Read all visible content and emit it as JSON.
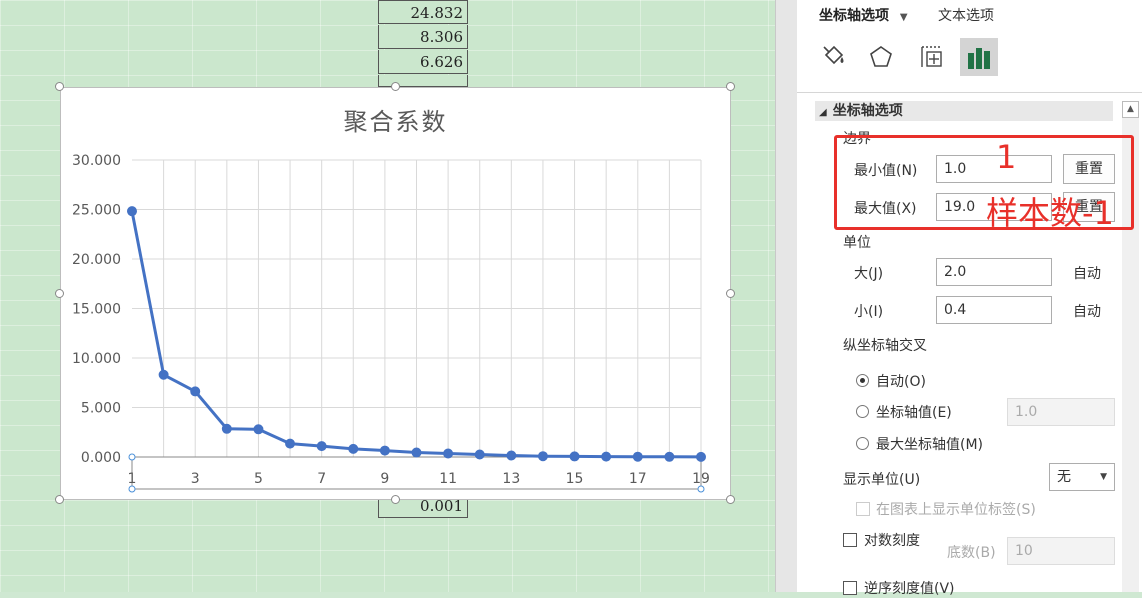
{
  "sheet": {
    "cells": [
      "24.832",
      "8.306",
      "6.626",
      "0.001"
    ]
  },
  "chart_data": {
    "type": "line",
    "title": "聚合系数",
    "x": [
      1,
      2,
      3,
      4,
      5,
      6,
      7,
      8,
      9,
      10,
      11,
      12,
      13,
      14,
      15,
      16,
      17,
      18,
      19
    ],
    "series": [
      {
        "values": [
          24.832,
          8.306,
          6.626,
          2.85,
          2.8,
          1.35,
          1.1,
          0.82,
          0.65,
          0.45,
          0.35,
          0.25,
          0.15,
          0.08,
          0.06,
          0.04,
          0.03,
          0.02,
          0.01
        ],
        "color": "#4472c4"
      }
    ],
    "xlim": [
      1,
      19
    ],
    "xticks": [
      "1",
      "3",
      "5",
      "7",
      "9",
      "11",
      "13",
      "15",
      "17",
      "19"
    ],
    "ylim": [
      0,
      30
    ],
    "yticks": [
      "0.000",
      "5.000",
      "10.000",
      "15.000",
      "20.000",
      "25.000",
      "30.000"
    ],
    "grid": true,
    "marker": "circle"
  },
  "pane": {
    "tab_axis": "坐标轴选项",
    "tab_text": "文本选项",
    "icons": [
      "fill-line-icon",
      "effects-icon",
      "size-properties-icon",
      "axis-options-icon"
    ],
    "section_title": "坐标轴选项",
    "bounds_label": "边界",
    "min_label": "最小值(N)",
    "min_value": "1.0",
    "max_label": "最大值(X)",
    "max_value": "19.0",
    "reset": "重置",
    "units_label": "单位",
    "major_label": "大(J)",
    "major_value": "2.0",
    "minor_label": "小(I)",
    "minor_value": "0.4",
    "auto": "自动",
    "crosses_label": "纵坐标轴交叉",
    "crosses_auto": "自动(O)",
    "crosses_value": "坐标轴值(E)",
    "crosses_value_input": "1.0",
    "crosses_max": "最大坐标轴值(M)",
    "display_units_label": "显示单位(U)",
    "display_units_value": "无",
    "show_units_label": "在图表上显示单位标签(S)",
    "log_scale": "对数刻度",
    "base_label": "底数(B)",
    "base_value": "10",
    "reverse": "逆序刻度值(V)"
  },
  "annotation": {
    "color": "#e8302a",
    "text_top": "1",
    "text_bottom": "样本数-1"
  }
}
